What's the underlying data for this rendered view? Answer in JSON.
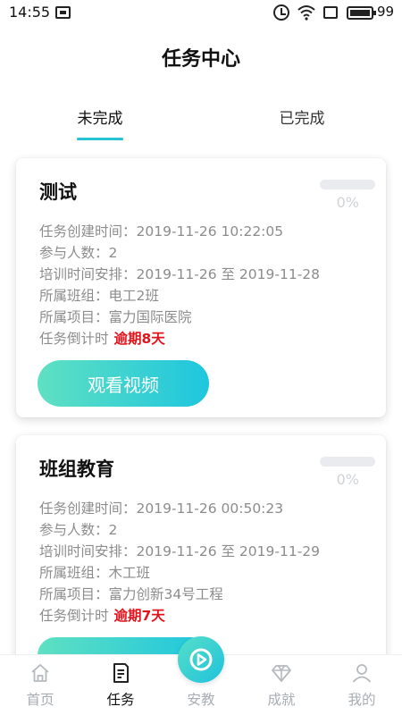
{
  "status_bar": {
    "time": "14:55",
    "battery": "99"
  },
  "header": {
    "title": "任务中心"
  },
  "tabs": [
    {
      "label": "未完成",
      "active": true
    },
    {
      "label": "已完成",
      "active": false
    }
  ],
  "tasks": [
    {
      "title": "测试",
      "progress": 0,
      "progress_text": "0%",
      "rows": [
        "任务创建时间：2019-11-26 10:22:05",
        "参与人数：2",
        "培训时间安排：2019-11-26 至 2019-11-28",
        "所属班组：电工2班",
        "所属项目：富力国际医院"
      ],
      "countdown_label": "任务倒计时",
      "countdown_value": "逾期8天",
      "button_label": "观看视频"
    },
    {
      "title": "班组教育",
      "progress": 0,
      "progress_text": "0%",
      "rows": [
        "任务创建时间：2019-11-26 00:50:23",
        "参与人数：2",
        "培训时间安排：2019-11-26 至 2019-11-29",
        "所属班组：木工班",
        "所属项目：富力创新34号工程"
      ],
      "countdown_label": "任务倒计时",
      "countdown_value": "逾期7天",
      "button_label": ""
    }
  ],
  "bottom_nav": [
    {
      "label": "首页",
      "icon": "home-icon",
      "active": false
    },
    {
      "label": "任务",
      "icon": "task-document-icon",
      "active": true
    },
    {
      "label": "安教",
      "icon": "play-logo-icon",
      "active": false
    },
    {
      "label": "成就",
      "icon": "diamond-icon",
      "active": false
    },
    {
      "label": "我的",
      "icon": "user-icon",
      "active": false
    }
  ],
  "colors": {
    "accent": "#27c3d3",
    "overdue": "#e0141c",
    "gradient_start": "#5fe0c2",
    "gradient_end": "#1ec6de"
  }
}
